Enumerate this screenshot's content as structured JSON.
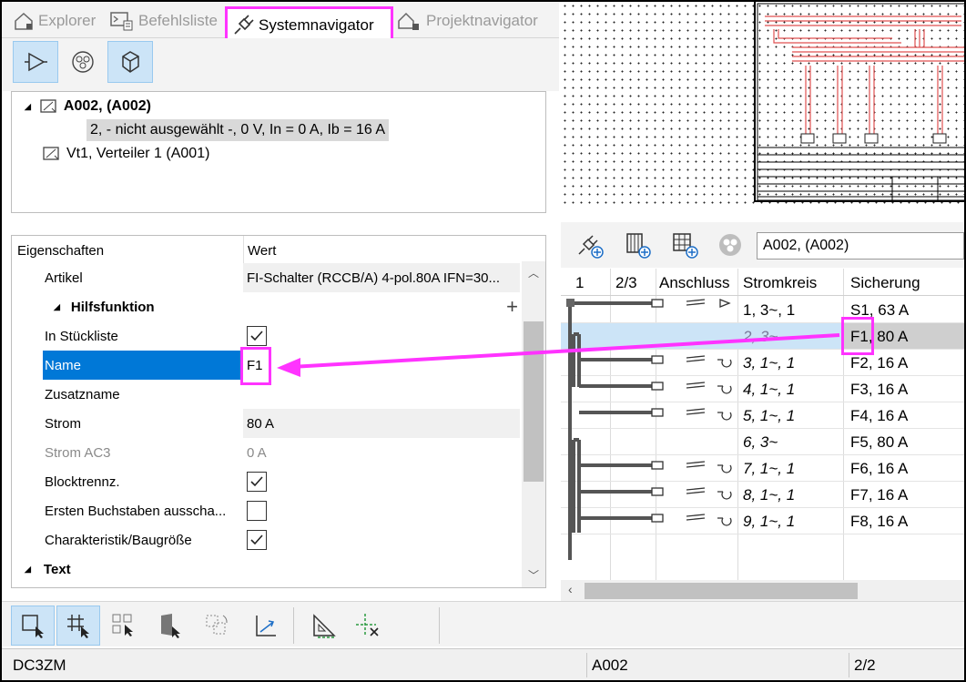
{
  "tabs": [
    {
      "label": "Explorer",
      "active": false
    },
    {
      "label": "Befehlsliste",
      "active": false
    },
    {
      "label": "Systemnavigator",
      "active": true
    },
    {
      "label": "Projektnavigator",
      "active": false
    }
  ],
  "tree": {
    "root_label": "A002,  (A002)",
    "child_label": "2,  - nicht ausgewählt -, 0 V, In = 0 A, Ib = 16 A",
    "second_label": "Vt1, Verteiler 1 (A001)"
  },
  "properties": {
    "col_name": "Eigenschaften",
    "col_value": "Wert",
    "rows": [
      {
        "label": "Artikel",
        "value": "FI-Schalter (RCCB/A) 4-pol.80A IFN=30..."
      },
      {
        "label": "Hilfsfunktion",
        "group": true
      },
      {
        "label": "In Stückliste",
        "checked": true
      },
      {
        "label": "Name",
        "value": "F1",
        "selected": true
      },
      {
        "label": "Zusatzname",
        "value": ""
      },
      {
        "label": "Strom",
        "value": "80 A"
      },
      {
        "label": "Strom AC3",
        "value": "0 A",
        "disabled": true
      },
      {
        "label": "Blocktrennz.",
        "checked": true
      },
      {
        "label": "Ersten Buchstaben ausscha...",
        "checked": false
      },
      {
        "label": "Charakteristik/Baugröße",
        "checked": true
      },
      {
        "label": "Text",
        "group": true
      }
    ]
  },
  "right_toolbar": {
    "combo_value": "A002,  (A002)"
  },
  "grid": {
    "headers": [
      "1",
      "2/3",
      "Anschluss",
      "Stromkreis",
      "Sicherung"
    ],
    "rows": [
      {
        "stromkreis": "1, 3~, 1",
        "sicherung": "S1, 63 A",
        "italic": false
      },
      {
        "stromkreis": "2, 3~",
        "sicherung": "F1, 80 A",
        "selected": true
      },
      {
        "stromkreis": "3, 1~, 1",
        "sicherung": "F2, 16 A"
      },
      {
        "stromkreis": "4, 1~, 1",
        "sicherung": "F3, 16 A"
      },
      {
        "stromkreis": "5, 1~, 1",
        "sicherung": "F4, 16 A"
      },
      {
        "stromkreis": "6, 3~",
        "sicherung": "F5, 80 A"
      },
      {
        "stromkreis": "7, 1~, 1",
        "sicherung": "F6, 16 A"
      },
      {
        "stromkreis": "8, 1~, 1",
        "sicherung": "F7, 16 A"
      },
      {
        "stromkreis": "9, 1~, 1",
        "sicherung": "F8, 16 A"
      }
    ]
  },
  "status": {
    "left": "DC3ZM",
    "middle": "A002",
    "right": "2/2"
  },
  "colors": {
    "highlight": "#ff33ff",
    "selection": "#0078d7",
    "row_selection": "#cce4f7"
  }
}
